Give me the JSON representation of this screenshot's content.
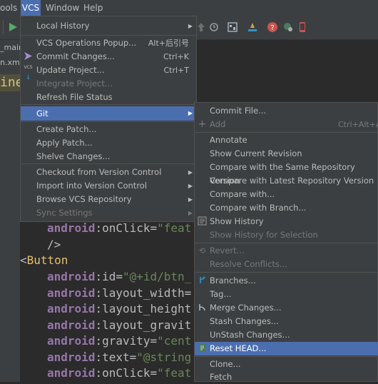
{
  "menubar": {
    "tools_fragment": "ools",
    "vcs": "VCS",
    "window": "Window",
    "help": "Help"
  },
  "editor": {
    "tab1": "_main",
    "tab2": "n.xml",
    "highlight_fragment": "inea",
    "lines": [
      {
        "ns": "android",
        "attr": "onClick",
        "val": "\"feat"
      },
      {
        "plain": "/>"
      },
      {
        "lt": "<",
        "tag": "Button"
      },
      {
        "ns": "android",
        "attr": "id",
        "val": "\"@+id/btn_"
      },
      {
        "ns": "android",
        "attr": "layout_width",
        "val": "="
      },
      {
        "ns": "android",
        "attr": "layout_height",
        "val": ""
      },
      {
        "ns": "android",
        "attr": "layout_gravit",
        "val": ""
      },
      {
        "ns": "android",
        "attr": "gravity",
        "val": "\"cent"
      },
      {
        "ns": "android",
        "attr": "text",
        "val": "\"@string"
      },
      {
        "ns": "android",
        "attr": "onClick",
        "val": "\"feat"
      }
    ]
  },
  "vcs_menu": {
    "items": [
      {
        "label": "Local History",
        "submenu": true
      },
      {
        "label": "VCS Operations Popup...",
        "shortcut": "Alt+后引号"
      },
      {
        "label": "Commit Changes...",
        "shortcut": "Ctrl+K",
        "icon": "commit-arrow-icon"
      },
      {
        "label": "Update Project...",
        "shortcut": "Ctrl+T",
        "icon": "vcs-update-icon",
        "icon_text": "VCS"
      },
      {
        "label": "Integrate Project...",
        "disabled": true
      },
      {
        "label": "Refresh File Status"
      },
      {
        "label": "Git",
        "submenu": true,
        "selected": true
      },
      {
        "label": "Create Patch..."
      },
      {
        "label": "Apply Patch..."
      },
      {
        "label": "Shelve Changes..."
      },
      {
        "label": "Checkout from Version Control",
        "submenu": true
      },
      {
        "label": "Import into Version Control",
        "submenu": true
      },
      {
        "label": "Browse VCS Repository",
        "submenu": true
      },
      {
        "label": "Sync Settings",
        "submenu": true,
        "disabled": true
      }
    ]
  },
  "git_menu": {
    "items": [
      {
        "label": "Commit File..."
      },
      {
        "label": "Add",
        "shortcut": "Ctrl+Alt+A",
        "disabled": true,
        "icon": "plus-icon"
      },
      {
        "label": "Annotate"
      },
      {
        "label": "Show Current Revision"
      },
      {
        "label": "Compare with the Same Repository Version"
      },
      {
        "label": "Compare with Latest Repository Version"
      },
      {
        "label": "Compare with..."
      },
      {
        "label": "Compare with Branch..."
      },
      {
        "label": "Show History",
        "icon": "history-icon"
      },
      {
        "label": "Show History for Selection",
        "disabled": true
      },
      {
        "label": "Revert...",
        "disabled": true,
        "icon": "revert-icon"
      },
      {
        "label": "Resolve Conflicts...",
        "disabled": true
      },
      {
        "label": "Branches...",
        "icon": "branch-icon"
      },
      {
        "label": "Tag..."
      },
      {
        "label": "Merge Changes...",
        "icon": "merge-icon"
      },
      {
        "label": "Stash Changes..."
      },
      {
        "label": "UnStash Changes..."
      },
      {
        "label": "Reset HEAD...",
        "selected": true,
        "icon": "reset-icon"
      },
      {
        "label": "Clone..."
      },
      {
        "label": "Fetch"
      }
    ]
  }
}
